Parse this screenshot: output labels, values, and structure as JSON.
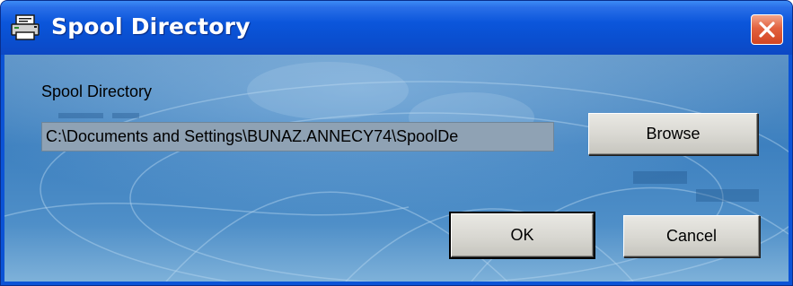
{
  "window": {
    "title": "Spool Directory",
    "icon": "printer-icon",
    "close_icon": "close-icon",
    "close_color": "#d9512c",
    "titlebar_color": "#0b56db"
  },
  "form": {
    "label": "Spool Directory",
    "path_value": "C:\\Documents and Settings\\BUNAZ.ANNECY74\\SpoolDe",
    "browse_label": "Browse"
  },
  "actions": {
    "ok_label": "OK",
    "cancel_label": "Cancel"
  }
}
